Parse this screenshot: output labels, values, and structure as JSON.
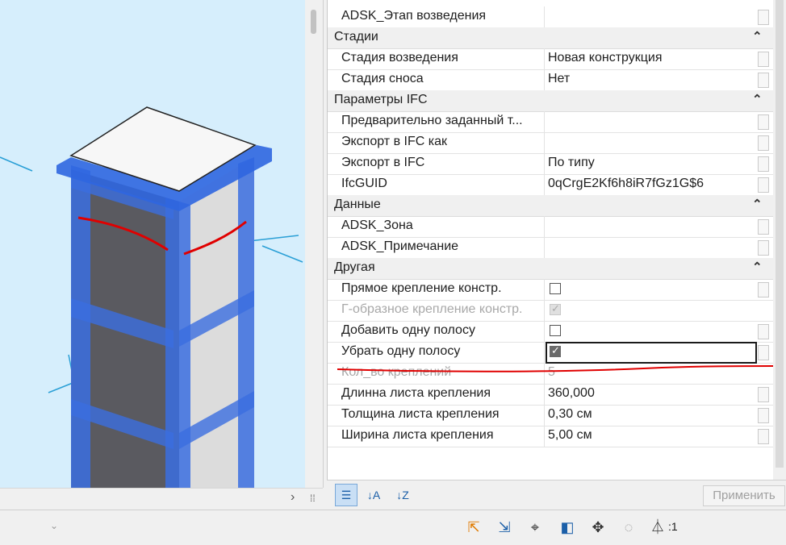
{
  "properties": {
    "top_row": {
      "name": "ADSK_Этап возведения",
      "value": ""
    },
    "groups": [
      {
        "title": "Стадии",
        "rows": [
          {
            "name": "Стадия возведения",
            "value": "Новая конструкция"
          },
          {
            "name": "Стадия сноса",
            "value": "Нет"
          }
        ]
      },
      {
        "title": "Параметры IFC",
        "rows": [
          {
            "name": "Предварительно заданный т...",
            "value": ""
          },
          {
            "name": "Экспорт в IFC как",
            "value": ""
          },
          {
            "name": "Экспорт в IFC",
            "value": "По типу"
          },
          {
            "name": "IfcGUID",
            "value": "0qCrgE2Kf6h8iR7fGz1G$6"
          }
        ]
      },
      {
        "title": "Данные",
        "rows": [
          {
            "name": "ADSK_Зона",
            "value": ""
          },
          {
            "name": "ADSK_Примечание",
            "value": ""
          }
        ]
      },
      {
        "title": "Другая",
        "rows": [
          {
            "name": "Прямое крепление констр.",
            "checkbox": false
          },
          {
            "name": "Г-образное крепление констр.",
            "checkbox": true,
            "disabled": true
          },
          {
            "name": "Добавить одну полосу",
            "checkbox": false
          },
          {
            "name": "Убрать одну полосу",
            "checkbox": true,
            "selected": true
          },
          {
            "name": "Кол_во креплений",
            "value": "5",
            "disabled": true
          },
          {
            "name": "Длинна листа крепления",
            "value": "360,000"
          },
          {
            "name": "Толщина листа крепления",
            "value": "0,30 см"
          },
          {
            "name": "Ширина листа крепления",
            "value": "5,00 см"
          }
        ]
      }
    ],
    "apply_label": "Применить",
    "filter_count": ":1"
  },
  "icons": [
    "sort-categorized-icon",
    "sort-ascending-icon",
    "sort-descending-icon"
  ],
  "colors": {
    "accent": "#1b5fa8",
    "viewport_bg": "#d6eefc",
    "annotation_red": "#e00000"
  }
}
